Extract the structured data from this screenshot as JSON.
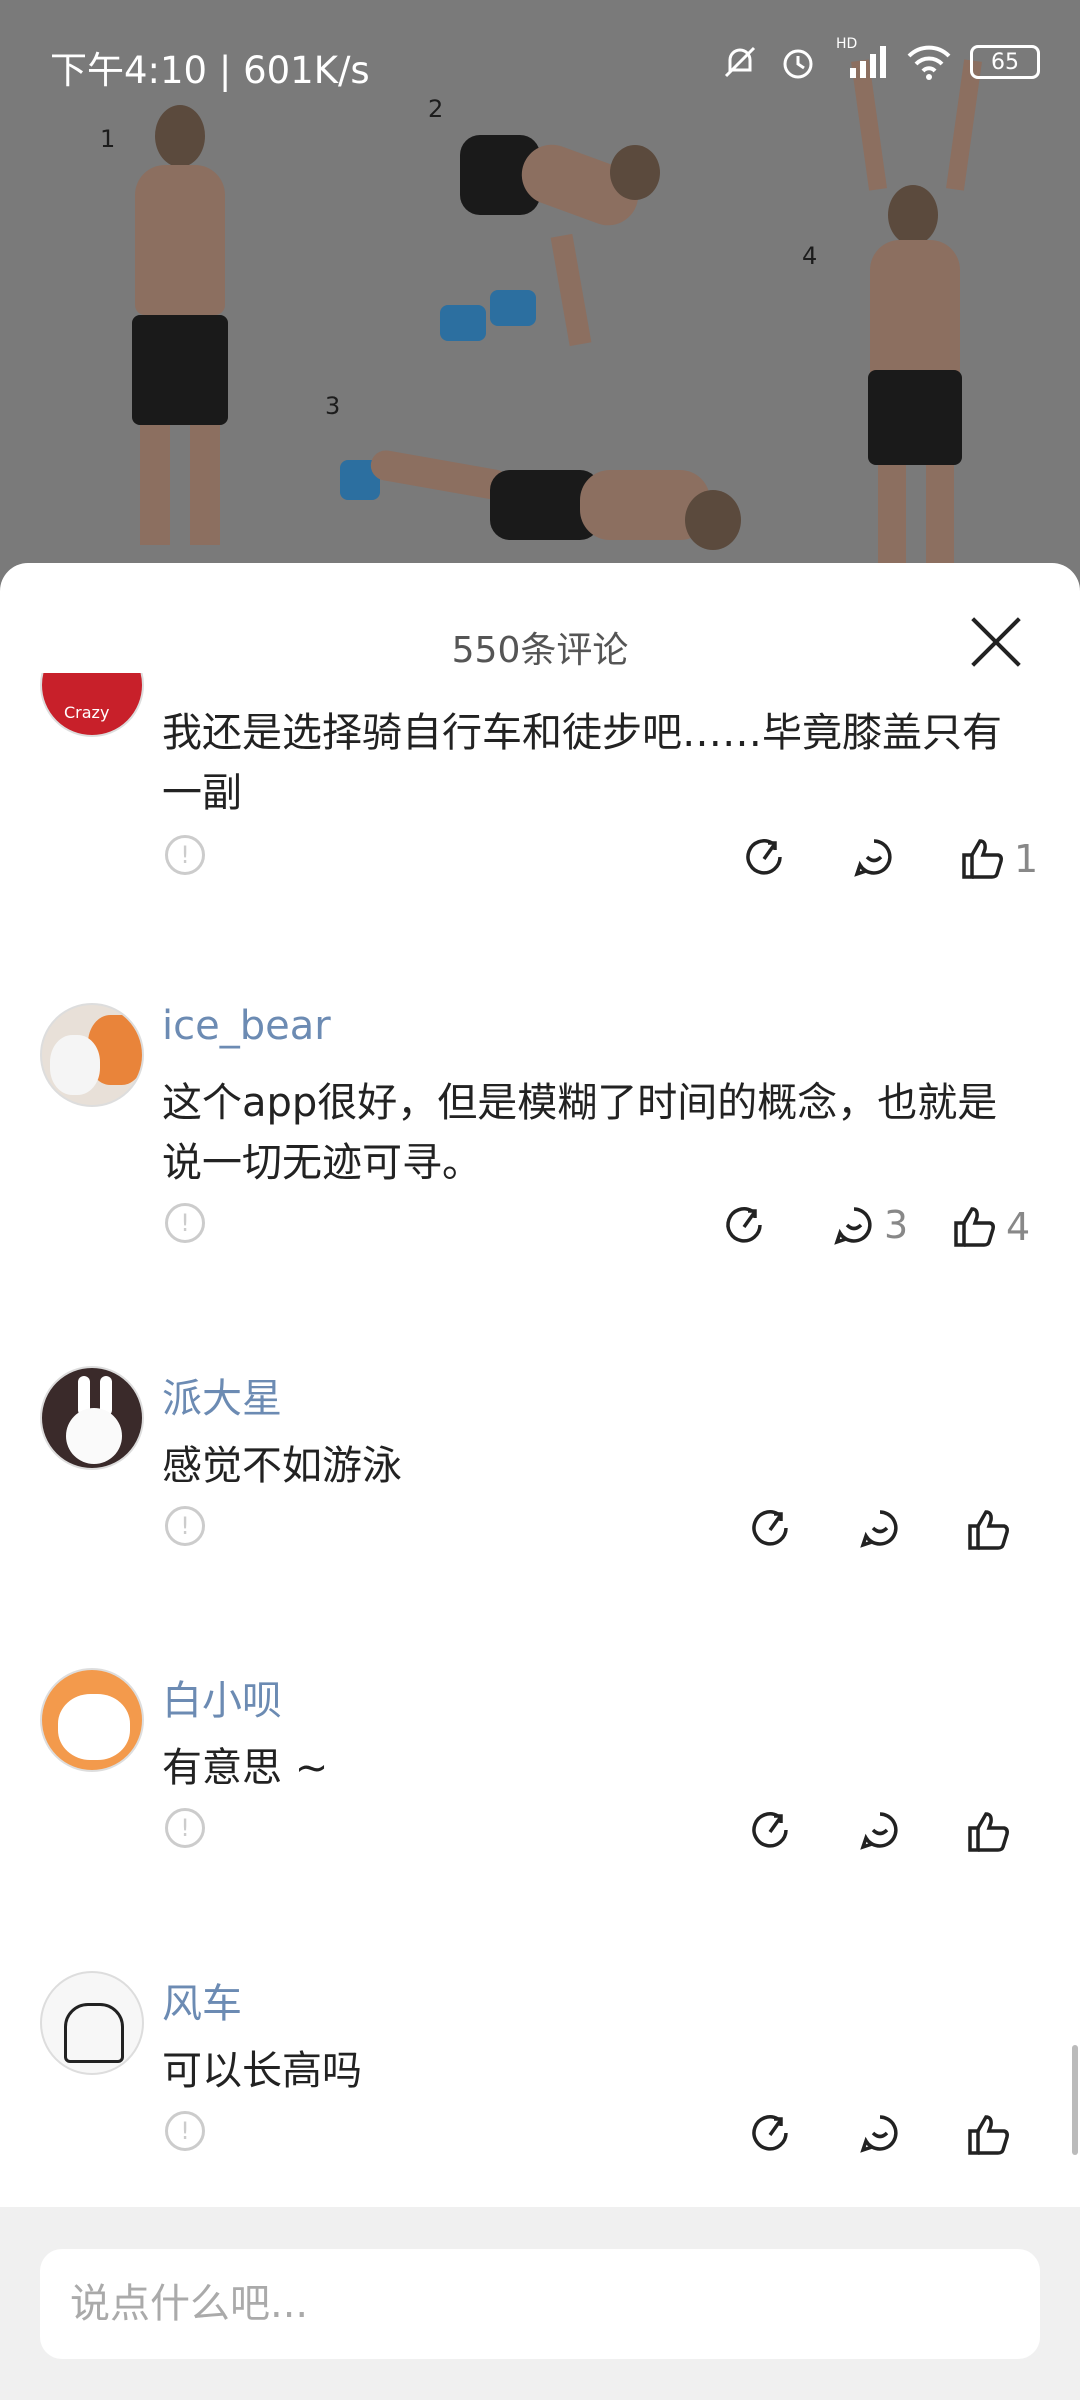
{
  "status_bar": {
    "time": "下午4:10 | 601K/s",
    "battery": "65",
    "network_label": "HD"
  },
  "background": {
    "frame_labels": [
      "1",
      "2",
      "3",
      "4"
    ]
  },
  "sheet": {
    "title": "550条评论"
  },
  "comments": [
    {
      "username": "",
      "text": "我还是选择骑自行车和徒步吧……毕竟膝盖只有一副",
      "reply_count": "",
      "like_count": "1",
      "avatar_label": "Crazy"
    },
    {
      "username": "ice_bear",
      "text": "这个app很好，但是模糊了时间的概念，也就是说一切无迹可寻。",
      "reply_count": "3",
      "like_count": "4"
    },
    {
      "username": "派大星",
      "text": "感觉不如游泳",
      "reply_count": "",
      "like_count": ""
    },
    {
      "username": "白小呗",
      "text": "有意思 ~",
      "reply_count": "",
      "like_count": ""
    },
    {
      "username": "风车",
      "text": "可以长高吗",
      "reply_count": "",
      "like_count": ""
    }
  ],
  "input": {
    "placeholder": "说点什么吧..."
  },
  "colors": {
    "username": "#6c8bb3",
    "overlay": "#7a7a7a",
    "input_bar": "#f0f0f0"
  },
  "icons": [
    "bell-off-icon",
    "alarm-icon",
    "signal-icon",
    "wifi-icon",
    "battery-icon",
    "close-icon",
    "report-icon",
    "share-icon",
    "reply-icon",
    "like-icon"
  ]
}
